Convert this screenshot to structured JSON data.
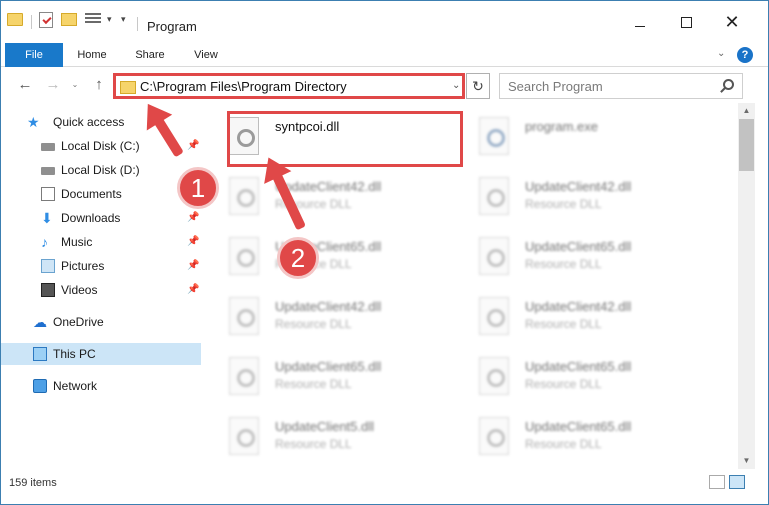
{
  "window": {
    "title": "Program",
    "minimize_label": "",
    "maximize_label": "",
    "close_label": "✕"
  },
  "ribbon": {
    "tabs": [
      "File",
      "Home",
      "Share",
      "View"
    ],
    "expand_glyph": "⌄",
    "help_glyph": "?"
  },
  "nav": {
    "back_glyph": "←",
    "forward_glyph": "→",
    "recent_glyph": "⌄",
    "up_glyph": "↑",
    "address": "C:\\Program Files\\Program Directory",
    "address_drop_glyph": "⌄",
    "refresh_glyph": "↻",
    "search_placeholder": "Search Program"
  },
  "sidebar": {
    "items": [
      {
        "label": "Quick access",
        "icon": "star-icon",
        "pinned": false
      },
      {
        "label": "Local Disk (C:)",
        "icon": "drive-icon",
        "pinned": true
      },
      {
        "label": "Local Disk (D:)",
        "icon": "drive-icon",
        "pinned": false
      },
      {
        "label": "Documents",
        "icon": "documents-icon",
        "pinned": true
      },
      {
        "label": "Downloads",
        "icon": "download-icon",
        "pinned": true
      },
      {
        "label": "Music",
        "icon": "music-icon",
        "pinned": true
      },
      {
        "label": "Pictures",
        "icon": "pictures-icon",
        "pinned": true
      },
      {
        "label": "Videos",
        "icon": "videos-icon",
        "pinned": true
      },
      {
        "label": "OneDrive",
        "icon": "cloud-icon",
        "pinned": false
      },
      {
        "label": "This PC",
        "icon": "computer-icon",
        "pinned": false,
        "selected": true
      },
      {
        "label": "Network",
        "icon": "network-icon",
        "pinned": false
      }
    ],
    "pin_glyph": "📌"
  },
  "files": [
    {
      "name": "syntpcoi.dll",
      "type": ""
    },
    {
      "name": "program.exe",
      "type": ""
    },
    {
      "name": "UpdateClient42.dll",
      "type": "Resource DLL"
    },
    {
      "name": "UpdateClient42.dll",
      "type": "Resource DLL"
    },
    {
      "name": "UpdateClient65.dll",
      "type": "Resource DLL"
    },
    {
      "name": "UpdateClient65.dll",
      "type": "Resource DLL"
    },
    {
      "name": "UpdateClient42.dll",
      "type": "Resource DLL"
    },
    {
      "name": "UpdateClient42.dll",
      "type": "Resource DLL"
    },
    {
      "name": "UpdateClient65.dll",
      "type": "Resource DLL"
    },
    {
      "name": "UpdateClient65.dll",
      "type": "Resource DLL"
    },
    {
      "name": "UpdateClient5.dll",
      "type": "Resource DLL"
    },
    {
      "name": "UpdateClient65.dll",
      "type": "Resource DLL"
    }
  ],
  "status": {
    "item_count": "159 items"
  },
  "annotations": {
    "marker_1": "1",
    "marker_2": "2",
    "color": "#e04848"
  },
  "scrollbar": {
    "up_glyph": "▲",
    "down_glyph": "▼"
  }
}
